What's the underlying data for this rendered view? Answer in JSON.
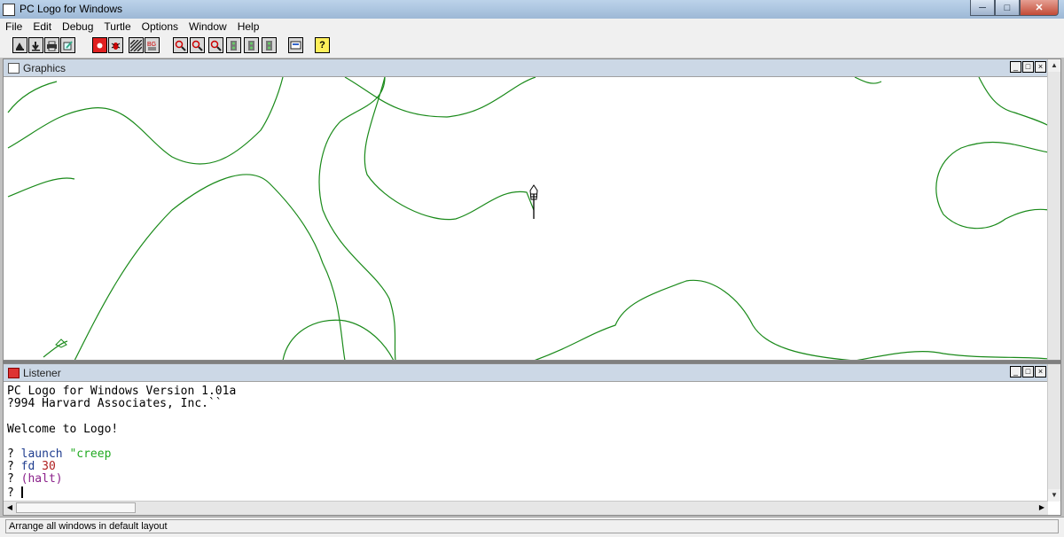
{
  "window": {
    "title": "PC Logo for Windows"
  },
  "menu": [
    "File",
    "Edit",
    "Debug",
    "Turtle",
    "Options",
    "Window",
    "Help"
  ],
  "toolbar": {
    "buttons": [
      "open-file",
      "save-file",
      "print",
      "edit",
      "stop",
      "bug",
      "pen-pattern",
      "bg-pattern",
      "zoom-in",
      "zoom-out",
      "zoom-reset",
      "traffic-light-1",
      "traffic-light-2",
      "traffic-light-3",
      "monitor",
      "help"
    ]
  },
  "graphics": {
    "title": "Graphics"
  },
  "listener": {
    "title": "Listener",
    "lines": [
      "PC Logo for Windows Version 1.01a",
      "?994 Harvard Associates, Inc.``",
      "",
      "Welcome to Logo!",
      ""
    ],
    "cmd1_prompt": "? ",
    "cmd1_keyword": "launch",
    "cmd1_arg": "\"creep",
    "cmd2_prompt": "? ",
    "cmd2_keyword": "fd",
    "cmd2_arg": "30",
    "cmd3_prompt": "? ",
    "cmd3_text": "(halt)",
    "cmd4_prompt": "? "
  },
  "status": {
    "text": "Arrange all windows in default layout"
  },
  "colors": {
    "trail": "#1a8a1a",
    "titlebar": "#bcd3ea",
    "childbar": "#ccd8e6"
  }
}
